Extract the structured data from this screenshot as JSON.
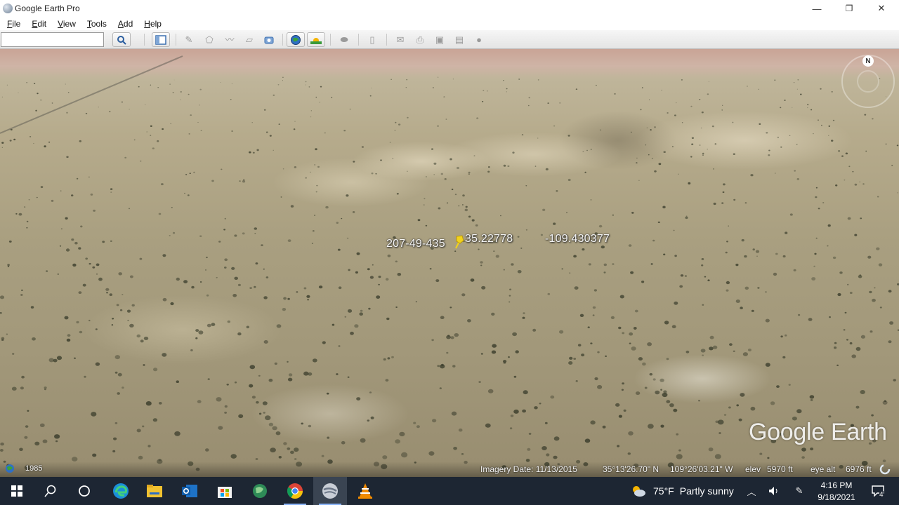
{
  "window": {
    "title": "Google Earth Pro",
    "controls": {
      "minimize": "—",
      "maximize": "❐",
      "close": "✕"
    }
  },
  "menu": [
    "File",
    "Edit",
    "View",
    "Tools",
    "Add",
    "Help"
  ],
  "search": {
    "value": "",
    "placeholder": ""
  },
  "toolbar": {
    "buttons": [
      "search-icon",
      "sidebar-toggle-icon",
      "placemark-icon",
      "polygon-icon",
      "path-icon",
      "overlay-icon",
      "tour-icon",
      "historical-imagery-icon",
      "sunlight-icon",
      "planets-icon",
      "ruler-icon",
      "email-icon",
      "print-icon",
      "save-image-icon",
      "maps-icon",
      "sky-icon"
    ]
  },
  "map": {
    "labels": {
      "left": "207-49-435",
      "center": "35.22778",
      "right": "-109.430377"
    },
    "compass_letter": "N",
    "watermark": "Google Earth",
    "colors": {
      "label": "#f5f5f5",
      "pin": "#f2d21b"
    }
  },
  "status": {
    "year": "1985",
    "imagery_date": "Imagery Date: 11/13/2015",
    "lat": "35°13'26.70\" N",
    "lon": "109°26'03.21\" W",
    "elev_label": "elev",
    "elev_value": "5970 ft",
    "eye_label": "eye alt",
    "eye_value": "6976 ft"
  },
  "taskbar": {
    "apps": [
      "windows-start-icon",
      "search-icon",
      "task-view-icon",
      "edge-icon",
      "file-explorer-icon",
      "outlook-icon",
      "store-icon",
      "maps-icon",
      "chrome-icon",
      "google-earth-icon",
      "vlc-icon"
    ],
    "weather": {
      "temp": "75°F",
      "desc": "Partly sunny"
    },
    "time": "4:16 PM",
    "date": "9/18/2021",
    "notifications": "4"
  }
}
